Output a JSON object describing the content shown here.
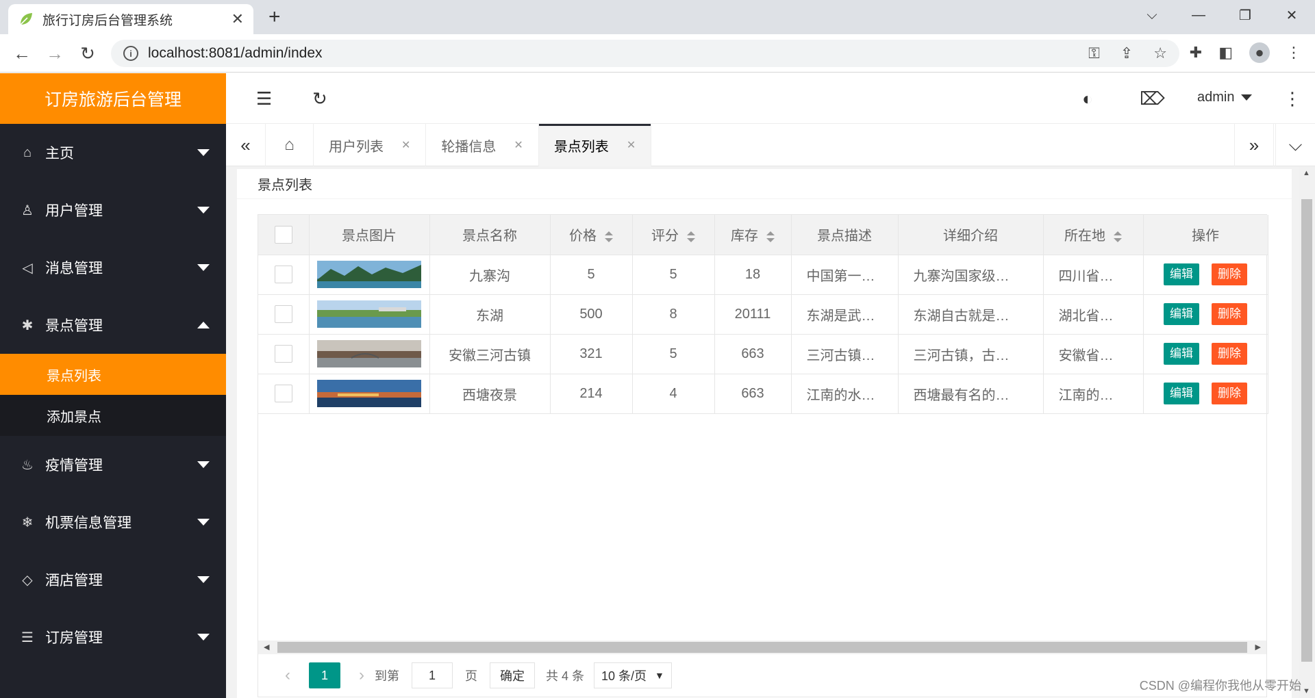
{
  "browser": {
    "tab_title": "旅行订房后台管理系统",
    "tab_close": "✕",
    "new_tab": "+",
    "url": "localhost:8081/admin/index"
  },
  "app": {
    "logo": "订房旅游后台管理",
    "admin_name": "admin",
    "brand_color": "#ff8c00"
  },
  "sidebar": {
    "items": [
      {
        "label": "主页",
        "icon": "home-icon"
      },
      {
        "label": "用户管理",
        "icon": "user-icon"
      },
      {
        "label": "消息管理",
        "icon": "speaker-icon"
      },
      {
        "label": "景点管理",
        "icon": "palm-icon"
      },
      {
        "label": "疫情管理",
        "icon": "fire-icon"
      },
      {
        "label": "机票信息管理",
        "icon": "snowflake-icon"
      },
      {
        "label": "酒店管理",
        "icon": "diamond-icon"
      },
      {
        "label": "订房管理",
        "icon": "list-icon"
      }
    ],
    "sub_items": [
      "景点列表",
      "添加景点"
    ]
  },
  "tabs": [
    "用户列表",
    "轮播信息",
    "景点列表"
  ],
  "card": {
    "title": "景点列表"
  },
  "table": {
    "headers": [
      "景点图片",
      "景点名称",
      "价格",
      "评分",
      "库存",
      "景点描述",
      "详细介绍",
      "所在地",
      "操作"
    ],
    "rows": [
      {
        "name": "九寨沟",
        "price": "5",
        "score": "5",
        "stock": "18",
        "desc": "中国第一…",
        "detail": "九寨沟国家级…",
        "location": "四川省…"
      },
      {
        "name": "东湖",
        "price": "500",
        "score": "8",
        "stock": "20111",
        "desc": "东湖是武…",
        "detail": "东湖自古就是…",
        "location": "湖北省…"
      },
      {
        "name": "安徽三河古镇",
        "price": "321",
        "score": "5",
        "stock": "663",
        "desc": "三河古镇…",
        "detail": "三河古镇，古…",
        "location": "安徽省…"
      },
      {
        "name": "西塘夜景",
        "price": "214",
        "score": "4",
        "stock": "663",
        "desc": "江南的水…",
        "detail": "西塘最有名的…",
        "location": "江南的…"
      }
    ],
    "edit_label": "编辑",
    "delete_label": "删除"
  },
  "pager": {
    "current": "1",
    "goto_prefix": "到第",
    "goto_value": "1",
    "goto_suffix": "页",
    "confirm": "确定",
    "total": "共 4 条",
    "page_size": "10 条/页"
  },
  "watermark": "CSDN @编程你我他从零开始"
}
